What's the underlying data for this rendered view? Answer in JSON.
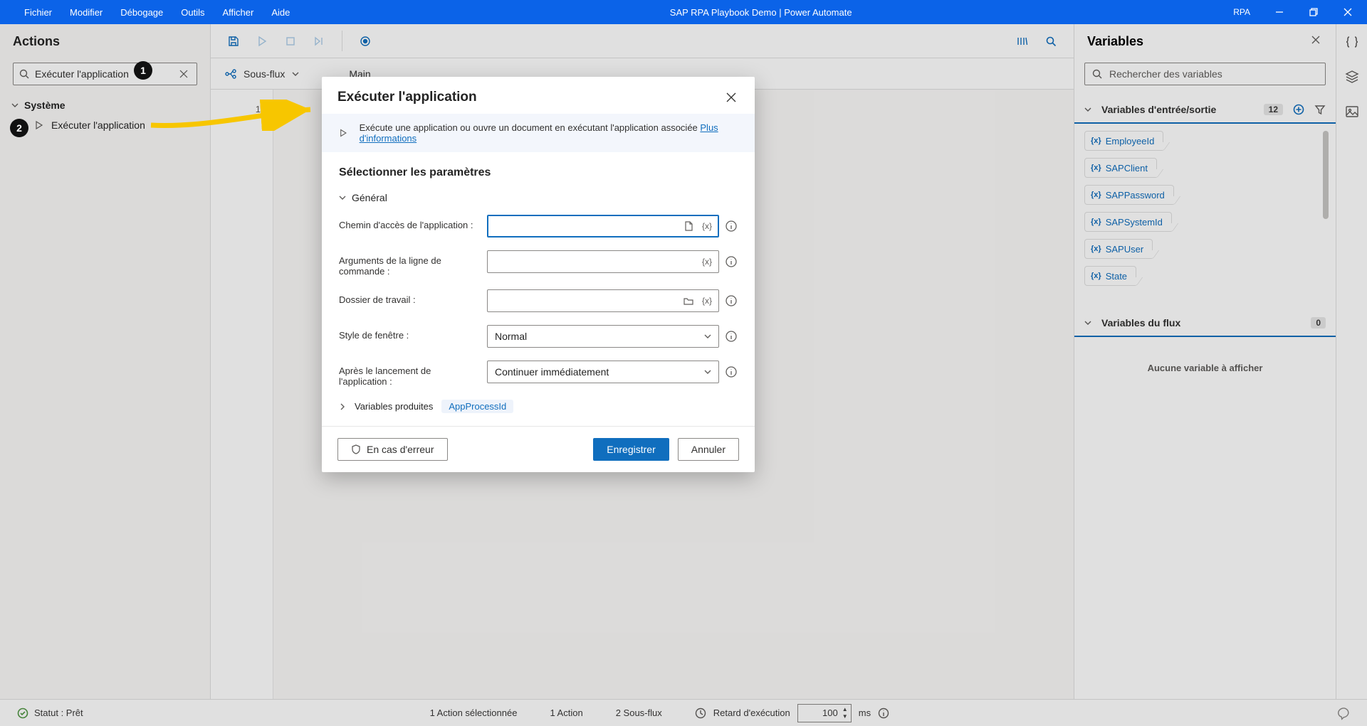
{
  "titlebar": {
    "menus": [
      "Fichier",
      "Modifier",
      "Débogage",
      "Outils",
      "Afficher",
      "Aide"
    ],
    "title": "SAP RPA Playbook Demo | Power Automate",
    "rpa_label": "RPA"
  },
  "actions": {
    "heading": "Actions",
    "search_value": "Exécuter l'application",
    "group": "Système",
    "item": "Exécuter l'application"
  },
  "toolbar": {},
  "subflow": {
    "label": "Sous-flux",
    "main_tab": "Main",
    "line_no": "1"
  },
  "variables": {
    "heading": "Variables",
    "search_placeholder": "Rechercher des variables",
    "in_out": {
      "title": "Variables d'entrée/sortie",
      "count": "12",
      "items": [
        "EmployeeId",
        "SAPClient",
        "SAPPassword",
        "SAPSystemId",
        "SAPUser",
        "State"
      ]
    },
    "flow": {
      "title": "Variables du flux",
      "count": "0",
      "none": "Aucune variable à afficher"
    }
  },
  "modal": {
    "title": "Exécuter l'application",
    "info_text": "Exécute une application ou ouvre un document en exécutant l'application associée ",
    "info_link": "Plus d'informations",
    "section_title": "Sélectionner les paramètres",
    "section_general": "Général",
    "fields": {
      "app_path": "Chemin d'accès de l'application :",
      "cli_args": "Arguments de la ligne de commande :",
      "work_dir": "Dossier de travail :",
      "window_style": "Style de fenêtre :",
      "after_launch": "Après le lancement de l'application :"
    },
    "select_window_style": "Normal",
    "select_after_launch": "Continuer immédiatement",
    "produced_label": "Variables produites",
    "produced_var": "AppProcessId",
    "error_btn": "En cas d'erreur",
    "save_btn": "Enregistrer",
    "cancel_btn": "Annuler"
  },
  "status": {
    "ready": "Statut : Prêt",
    "sel": "1 Action sélectionnée",
    "actions": "1 Action",
    "subflows": "2 Sous-flux",
    "delay_label": "Retard d'exécution",
    "delay_value": "100",
    "delay_unit": "ms"
  },
  "callouts": {
    "c1": "1",
    "c2": "2"
  }
}
